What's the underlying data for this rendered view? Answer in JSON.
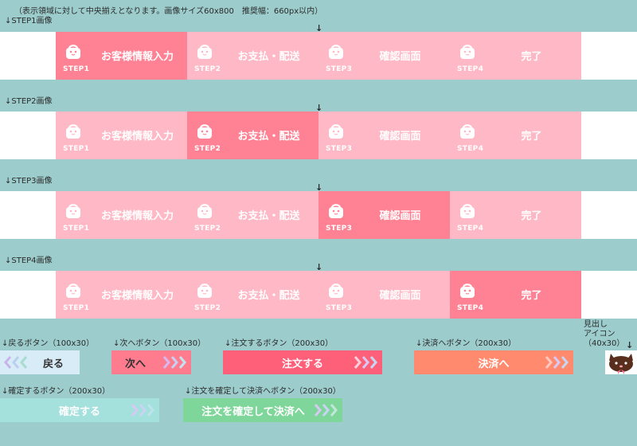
{
  "header_note": "（表示領域に対して中央揃えとなります。画像サイズ60x800　推奨幅：660px以内）",
  "sections": [
    {
      "label": "↓STEP1画像",
      "active": 0
    },
    {
      "label": "↓STEP2画像",
      "active": 1
    },
    {
      "label": "↓STEP3画像",
      "active": 2
    },
    {
      "label": "↓STEP4画像",
      "active": 3
    }
  ],
  "center_marker": "↓",
  "steps": [
    {
      "num": "STEP1",
      "label": "お客様情報入力"
    },
    {
      "num": "STEP2",
      "label": "お支払・配送"
    },
    {
      "num": "STEP3",
      "label": "確認画面"
    },
    {
      "num": "STEP4",
      "label": "完了"
    }
  ],
  "buttons": {
    "back": {
      "caption": "↓戻るボタン（100x30）",
      "label": "戻る"
    },
    "next": {
      "caption": "↓次へボタン（100x30）",
      "label": "次へ"
    },
    "order": {
      "caption": "↓注文するボタン（200x30）",
      "label": "注文する"
    },
    "payment": {
      "caption": "↓決済へボタン（200x30）",
      "label": "決済へ"
    },
    "confirm": {
      "caption": "↓確定するボタン（200x30）",
      "label": "確定する"
    },
    "confirm_pay": {
      "caption": "↓注文を確定して決済へボタン（200x30）",
      "label": "注文を確定して決済へ"
    }
  },
  "heading_icon": {
    "caption_line1": "見出し",
    "caption_line2": "アイコン",
    "caption_line3": "（40x30）",
    "arrow": "↓"
  },
  "colors": {
    "background": "#9ccccc",
    "step_inactive": "#ffb8c5",
    "step_active": "#ff8294",
    "back_button": "#d8ecf8",
    "next_button": "#ff7b8e",
    "order_button": "#ff6079",
    "payment_button": "#ff8a6e",
    "confirm_button": "#a4e0dc",
    "confirm_pay_button": "#7fd69a"
  },
  "icons": {
    "step": "shopping-bag-icon",
    "chevrons": "chevron-arrows-icon",
    "heading": "cat-face-icon"
  }
}
